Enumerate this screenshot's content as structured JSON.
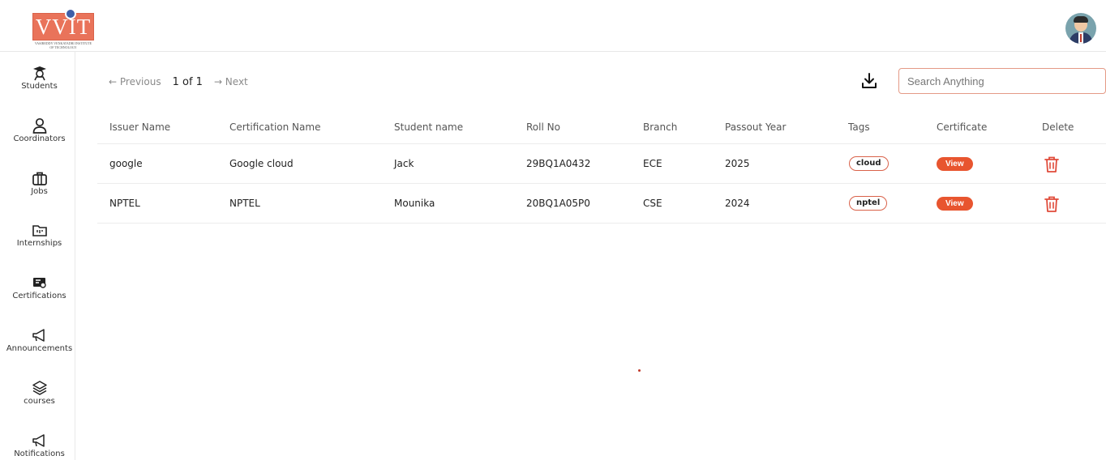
{
  "header": {
    "logo_text": "VVIT",
    "logo_subtitle": "VASIREDDY VENKATADRI INSTITUTE OF TECHNOLOGY",
    "avatar_icon": "user-avatar-icon"
  },
  "sidebar": {
    "items": [
      {
        "label": "Students",
        "icon": "graduate-icon"
      },
      {
        "label": "Coordinators",
        "icon": "user-icon"
      },
      {
        "label": "Jobs",
        "icon": "briefcase-icon"
      },
      {
        "label": "Internships",
        "icon": "folder-icon"
      },
      {
        "label": "Certifications",
        "icon": "certificate-icon"
      },
      {
        "label": "Announcements",
        "icon": "megaphone-icon"
      },
      {
        "label": "courses",
        "icon": "layers-icon"
      },
      {
        "label": "Notifications",
        "icon": "megaphone-icon"
      }
    ]
  },
  "toolbar": {
    "prev_label": "← Previous",
    "page_label": "1 of 1",
    "next_label": "→ Next",
    "search_placeholder": "Search Anything"
  },
  "table": {
    "columns": [
      "Issuer Name",
      "Certification Name",
      "Student name",
      "Roll No",
      "Branch",
      "Passout Year",
      "Tags",
      "Certificate",
      "Delete"
    ],
    "rows": [
      {
        "issuer": "google",
        "certification": "Google cloud",
        "student": "Jack",
        "roll": "29BQ1A0432",
        "branch": "ECE",
        "year": "2025",
        "tag": "cloud",
        "certificate": "View"
      },
      {
        "issuer": "NPTEL",
        "certification": "NPTEL",
        "student": "Mounika",
        "roll": "20BQ1A05P0",
        "branch": "CSE",
        "year": "2024",
        "tag": "nptel",
        "certificate": "View"
      }
    ]
  },
  "colors": {
    "accent": "#e8552f",
    "logo_bg": "#e9735a",
    "delete_icon": "#e04b3a"
  }
}
